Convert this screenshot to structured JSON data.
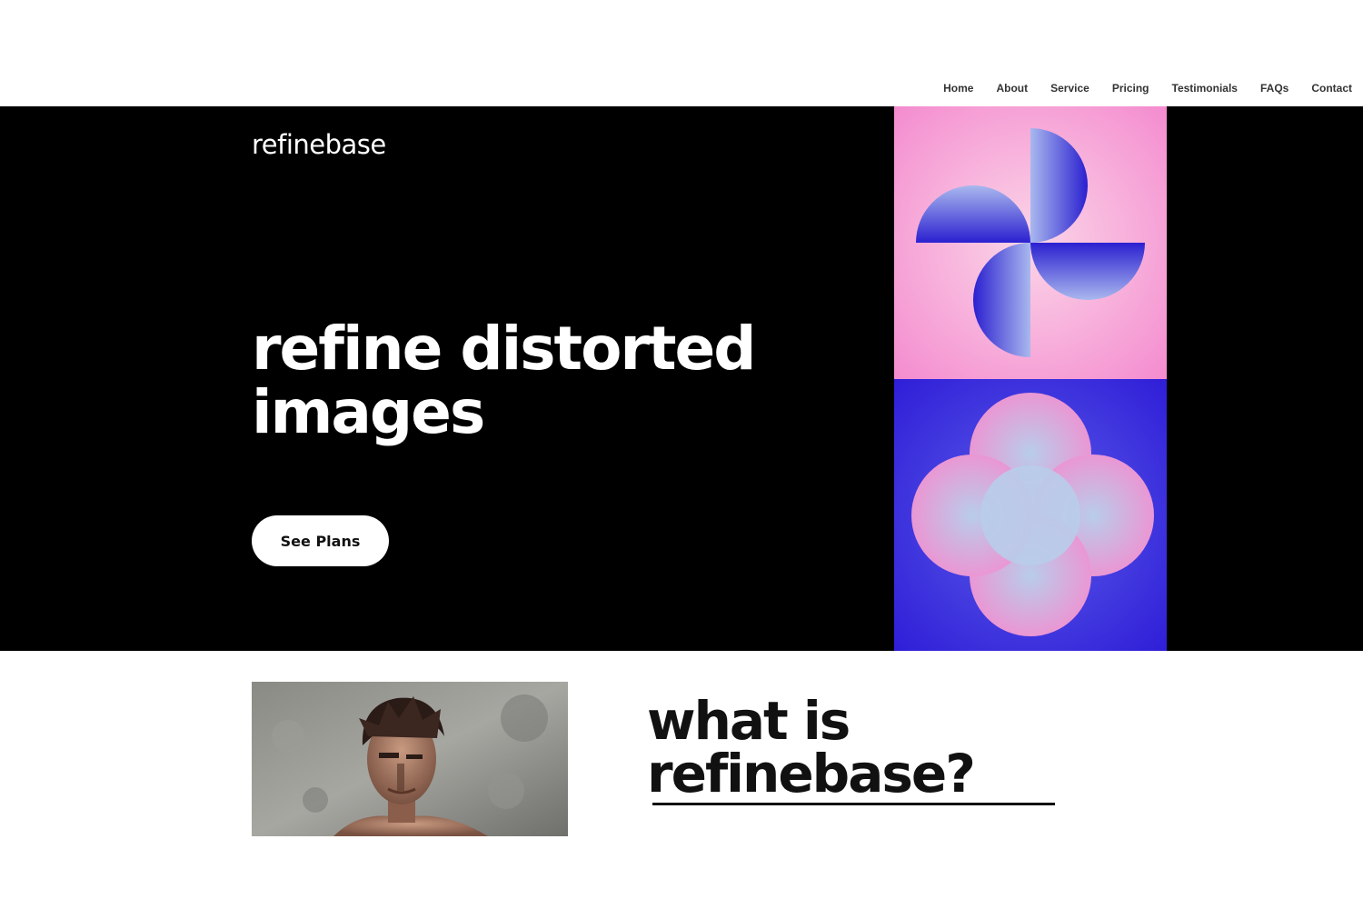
{
  "nav": {
    "items": [
      "Home",
      "About",
      "Service",
      "Pricing",
      "Testimonials",
      "FAQs",
      "Contact"
    ]
  },
  "hero": {
    "logo": "refinebase",
    "headline": "refine distorted images",
    "cta_label": "See Plans"
  },
  "about": {
    "title_line1": "what is",
    "title_line2": "refinebase?"
  },
  "colors": {
    "hero_bg": "#000000",
    "art_pink": "#f48ccf",
    "art_blue": "#2f1ed8",
    "text_dark": "#111111"
  }
}
